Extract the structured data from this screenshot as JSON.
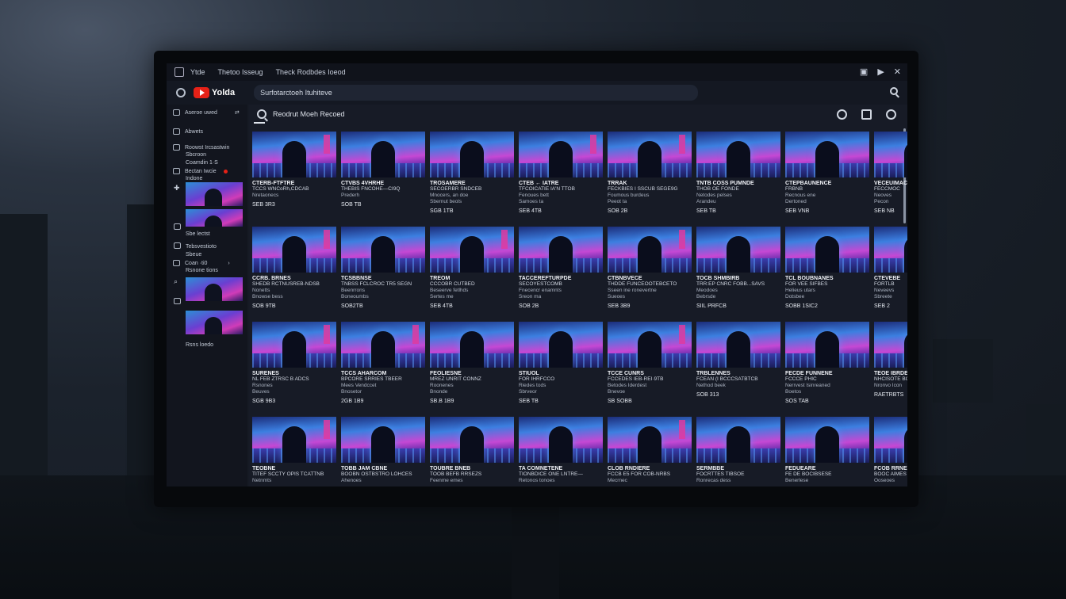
{
  "window": {
    "tab_label": "Ytde",
    "title1": "Thetoo Isseug",
    "title2": "Theck Rodbdes Ioeod"
  },
  "app": {
    "logo_text": "Yolda",
    "search_value": "Surfotarctoeh Ituhiteve"
  },
  "sidebar": {
    "header": "Aseroe uwed",
    "item_abwets": "Abwets",
    "line1": "Roowst Ircsastwin",
    "line2": "Sbcroon",
    "line3": "Coamdin 1·S",
    "line4": "Bectan Iwcie",
    "line5": "Indone",
    "line6": "Sbe lectst",
    "line7": "Tebsvestioto",
    "line8": "Sbeue",
    "line9": "Coan ·ti0",
    "line10": "Rsnone tions",
    "line11": "Rsns loedo"
  },
  "content": {
    "heading": "Reodrut Moeh Recoed"
  },
  "cards": [
    {
      "title": "CTERB-FTFTRE",
      "sub": "TCCS WNCoRh,CDCAB",
      "meta": "Nretaonecs",
      "meta2": "",
      "stat": "SEB 3R3"
    },
    {
      "title": "CTVBS 4VHRHE",
      "sub": "THEBIS FNCOHE—CI9Q",
      "meta": "Prederh",
      "meta2": "",
      "stat": "SOB TB"
    },
    {
      "title": "TROSAMERE",
      "sub": "SECOERBR SNDCEB",
      "meta": "Mnocers, an doe",
      "meta2": "Sbernut beols",
      "stat": "SGB 1TB"
    },
    {
      "title": "CTEB ← IATRE",
      "sub": "TFCOICATIE IA'N TTOB",
      "meta": "Fenoues bett",
      "meta2": "Samoes ta",
      "stat": "SEB 4TB"
    },
    {
      "title": "TRRAK",
      "sub": "FECKBIES I SSCUB SEGE9G",
      "meta": "Foumous burdeus",
      "meta2": "Peeot ta",
      "stat": "SOB 2B"
    },
    {
      "title": "TNTB COSS PUMNDE",
      "sub": "THOB OE FONDE",
      "meta": "Netodes pelses",
      "meta2": "Arandeu",
      "stat": "SEB TB"
    },
    {
      "title": "CTEPBAUNENCE",
      "sub": "FRBNB",
      "meta": "Recnous ene",
      "meta2": "Dertoned",
      "stat": "SEB VNB"
    },
    {
      "title": "VECEUIMAC",
      "sub": "FECCMOC",
      "meta": "Neoves",
      "meta2": "Pecon",
      "stat": "SEB NB"
    },
    {
      "title": "CCRB. BRNES",
      "sub": "SHEDB RCTNUSREB-NDSB",
      "meta": "Nonetts",
      "meta2": "Bnowse bess",
      "stat": "SOB 9TB"
    },
    {
      "title": "TCSBBNSE",
      "sub": "TNBSS FCLCROC TR5 SEGN",
      "meta": "Beenrrons",
      "meta2": "Boneoumbs",
      "stat": "SOB2TB"
    },
    {
      "title": "TREOM",
      "sub": "CCCOBR CUTBED",
      "meta": "Beseerve fetlhds",
      "meta2": "Sertes me",
      "stat": "SEB 4TB"
    },
    {
      "title": "TACCEREFTURPDE",
      "sub": "SECOYESTCOMB",
      "meta": "Fnecencr enamnts",
      "meta2": "Sreon ma",
      "stat": "SOB 2B"
    },
    {
      "title": "CTBNBVECE",
      "sub": "THDDE FUNCEOOTEBCETO",
      "meta": "Sseen ine ronevertne",
      "meta2": "Sueoes",
      "stat": "SEB 3B9"
    },
    {
      "title": "TOCB SHMBIRB",
      "sub": "TRR:EP CNRC FOBB...SAVS",
      "meta": "Meodoes",
      "meta2": "Bebrsde",
      "stat": "SIIL PRFCB"
    },
    {
      "title": "TCL BOUBNANES",
      "sub": "FOR VEE SIFBES",
      "meta": "Helieus utars",
      "meta2": "Dotsbee",
      "stat": "SOBB 1SIC2"
    },
    {
      "title": "CTEVEBE",
      "sub": "FORTLB",
      "meta": "Neveevs",
      "meta2": "Sbreete",
      "stat": "SEB 2"
    },
    {
      "title": "SURENES",
      "sub": "NL FEB ZTRSC B ADCS",
      "meta": "Rsnones",
      "meta2": "Beuves",
      "stat": "SGB 9B3"
    },
    {
      "title": "TCCS AHARCOM",
      "sub": "BPCORE SRRIES TBEER",
      "meta": "Mees Vendccet",
      "meta2": "Bnosetor",
      "stat": "2GB 1B9"
    },
    {
      "title": "FEOLIESNE",
      "sub": "MREZ UNRIT CONNZ",
      "meta": "Roonenes",
      "meta2": "Bnonde",
      "stat": "SB.B 1B9"
    },
    {
      "title": "STIUOL",
      "sub": "FOR IHRFCCO",
      "meta": "Riedes tods",
      "meta2": "Sbrveor",
      "stat": "SEB TB"
    },
    {
      "title": "TCCE CUNRS",
      "sub": "FCCEDES IEB-REI·9TB",
      "meta": "Betodes Iderdest",
      "meta2": "Bnevoe",
      "stat": "SB SOBB"
    },
    {
      "title": "TRBLENNES",
      "sub": "FCEAN (I BCCCSATBTCB",
      "meta": "Nethod beek",
      "meta2": "",
      "stat": "SOB 313"
    },
    {
      "title": "FECDE FUNNENE",
      "sub": "FCCCE PHIC",
      "meta": "Nerrvest Isinreaned",
      "meta2": "Boetos",
      "stat": "SOS TAB"
    },
    {
      "title": "TEOE IBRDES",
      "sub": "NHCISOTE BONTE",
      "meta": "Nronvo Icon",
      "meta2": "",
      "stat": "RAETRBTS"
    },
    {
      "title": "TEOBNE",
      "sub": "TITEF SCCTY OPIS TCATTNB",
      "meta": "Netnmts",
      "meta2": "",
      "stat": ""
    },
    {
      "title": "TOBB JAM CBNE",
      "sub": "BOOBN OSTBSTRO LOHCES",
      "meta": "Ahenoes",
      "meta2": "",
      "stat": ""
    },
    {
      "title": "TOUBRE BNEB",
      "sub": "TOOB BEFB RRSEZS",
      "meta": "Feenme emes",
      "meta2": "",
      "stat": ""
    },
    {
      "title": "TA COMNETENE",
      "sub": "TIONBDICE ONE LNTRE—",
      "meta": "Retonos tonoes",
      "meta2": "",
      "stat": ""
    },
    {
      "title": "CLOB RNDIERE",
      "sub": "FCCB E5 FOR COB-NRBS",
      "meta": "Mecrnec",
      "meta2": "",
      "stat": ""
    },
    {
      "title": "SERMBBE",
      "sub": "FOCRTTES TIBSOE",
      "meta": "Ronrecas dess",
      "meta2": "",
      "stat": ""
    },
    {
      "title": "FEDUEARE",
      "sub": "FE DE BOCIBSESE",
      "meta": "Benerlese",
      "meta2": "",
      "stat": ""
    },
    {
      "title": "FCOB RRNES",
      "sub": "BOOC AIMES",
      "meta": "Ooseoes",
      "meta2": "",
      "stat": ""
    }
  ]
}
